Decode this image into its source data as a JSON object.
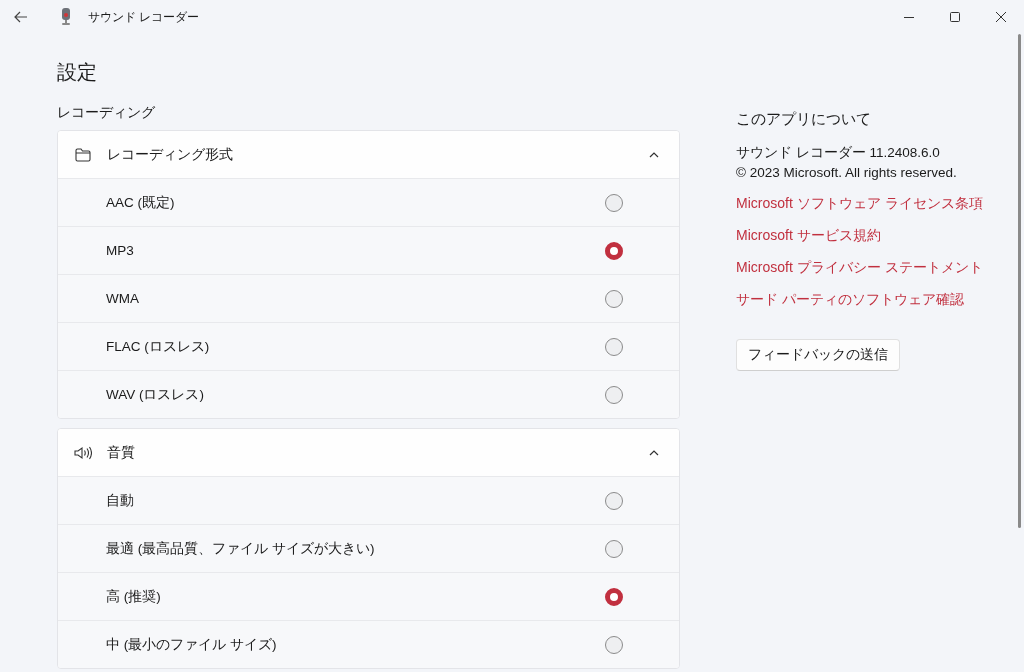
{
  "window": {
    "title": "サウンド レコーダー"
  },
  "page": {
    "title": "設定"
  },
  "section": {
    "title": "レコーディング"
  },
  "groups": [
    {
      "kind": "format",
      "title": "レコーディング形式",
      "expanded": true,
      "options": [
        {
          "label": "AAC (既定)",
          "selected": false
        },
        {
          "label": "MP3",
          "selected": true
        },
        {
          "label": "WMA",
          "selected": false
        },
        {
          "label": "FLAC (ロスレス)",
          "selected": false
        },
        {
          "label": "WAV (ロスレス)",
          "selected": false
        }
      ]
    },
    {
      "kind": "quality",
      "title": "音質",
      "expanded": true,
      "options": [
        {
          "label": "自動",
          "selected": false
        },
        {
          "label": "最適 (最高品質、ファイル サイズが大きい)",
          "selected": false
        },
        {
          "label": "高 (推奨)",
          "selected": true
        },
        {
          "label": "中 (最小のファイル サイズ)",
          "selected": false
        }
      ]
    }
  ],
  "about": {
    "title": "このアプリについて",
    "version": "サウンド レコーダー 11.2408.6.0",
    "copyright": "© 2023 Microsoft. All rights reserved.",
    "links": [
      "Microsoft ソフトウェア ライセンス条項",
      "Microsoft サービス規約",
      "Microsoft プライバシー ステートメント",
      "サード パーティのソフトウェア確認"
    ],
    "button": "フィードバックの送信"
  }
}
